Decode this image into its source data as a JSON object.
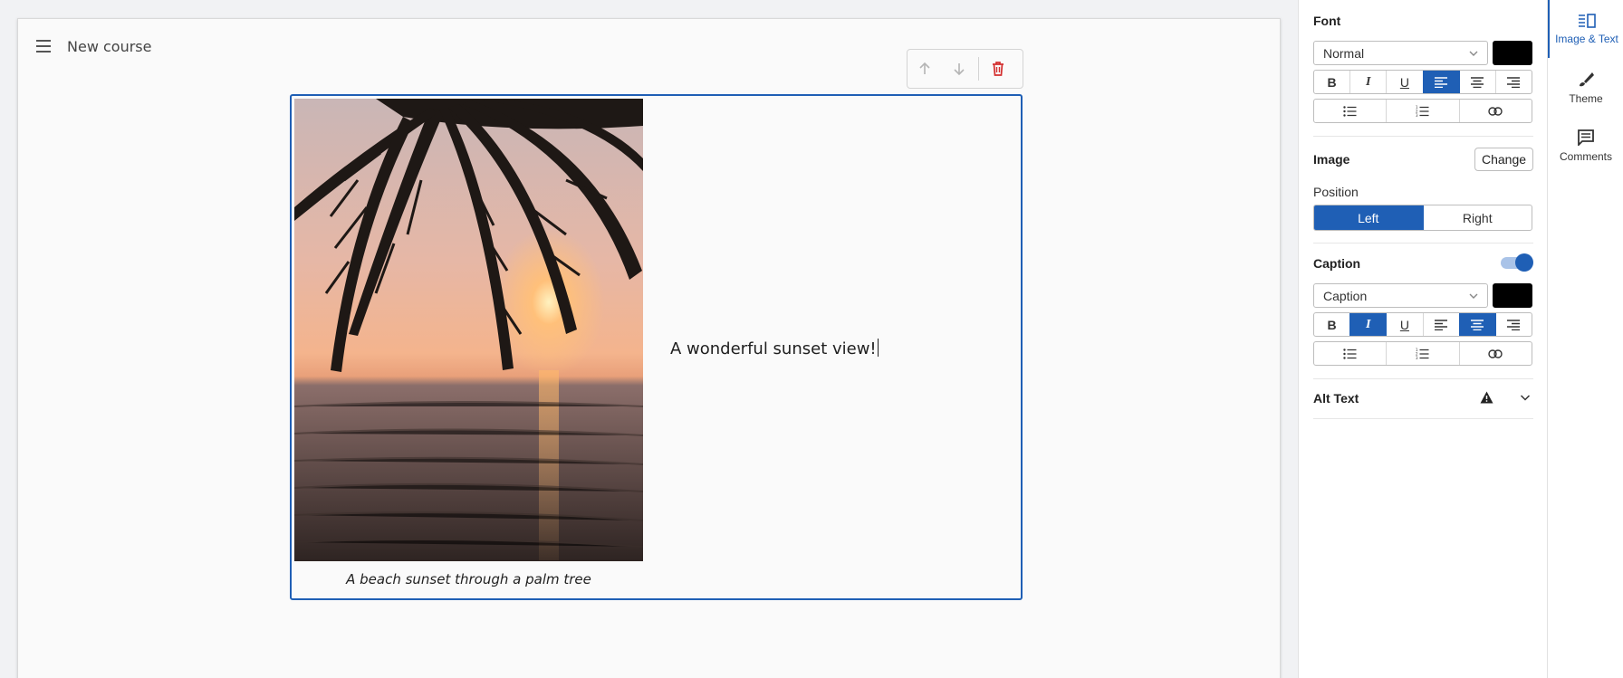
{
  "course": {
    "title": "New course"
  },
  "block": {
    "caption": "A beach sunset through a palm tree",
    "text": "A wonderful sunset view!"
  },
  "toolbar": {
    "up_icon": "arrow-up-icon",
    "down_icon": "arrow-down-icon",
    "delete_icon": "trash-icon"
  },
  "panel": {
    "font": {
      "label": "Font",
      "style_value": "Normal",
      "color": "#000000",
      "bold": "B",
      "italic": "I",
      "underline": "U",
      "alignment": "left"
    },
    "image": {
      "label": "Image",
      "change_label": "Change"
    },
    "position": {
      "label": "Position",
      "options": [
        "Left",
        "Right"
      ],
      "selected": "Left"
    },
    "caption": {
      "label": "Caption",
      "enabled": true,
      "style_value": "Caption",
      "color": "#000000",
      "bold": "B",
      "italic": "I",
      "underline": "U",
      "italic_on": true,
      "alignment": "center"
    },
    "alt_text": {
      "label": "Alt Text",
      "warning_icon": "warning-icon"
    }
  },
  "rail": {
    "items": [
      {
        "label": "Image & Text",
        "icon": "image-text-icon",
        "active": true
      },
      {
        "label": "Theme",
        "icon": "brush-icon",
        "active": false
      },
      {
        "label": "Comments",
        "icon": "comment-icon",
        "active": false
      }
    ]
  },
  "colors": {
    "accent": "#1f5fb5",
    "delete": "#d32f2f"
  }
}
